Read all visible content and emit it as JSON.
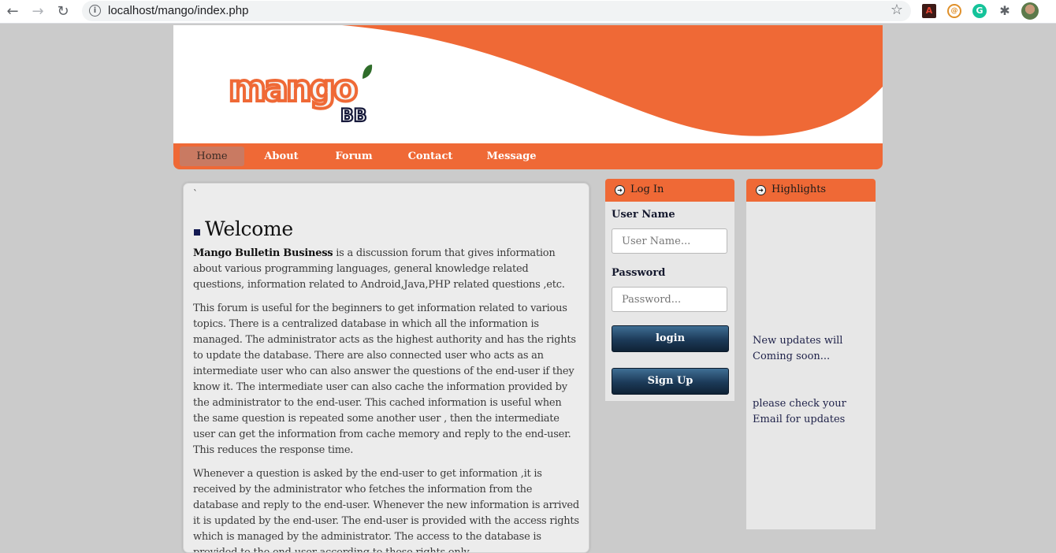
{
  "browser": {
    "url": "localhost/mango/index.php",
    "back_icon": "←",
    "forward_icon": "→",
    "reload_icon": "↻",
    "info_icon": "i",
    "star_icon": "☆",
    "puzzle_icon": "✱"
  },
  "logo": {
    "text": "mango",
    "badge": "BB"
  },
  "nav": {
    "items": [
      {
        "label": "Home",
        "active": true
      },
      {
        "label": "About"
      },
      {
        "label": "Forum"
      },
      {
        "label": "Contact"
      },
      {
        "label": "Message"
      }
    ]
  },
  "main": {
    "tick": "`",
    "heading": "Welcome",
    "intro_bold": "Mango Bulletin Business",
    "intro_rest": " is a discussion forum that gives information about various programming languages, general knowledge related questions, information related to Android,Java,PHP related questions ,etc.",
    "para2": "This forum is useful for the beginners to get information related to various topics. There is a centralized database in which all the information is managed. The administrator acts as the highest authority and has the rights to update the database. There are also connected user who acts as an intermediate user who can also answer the questions of the end-user if they know it. The intermediate user can also cache the information provided by the administrator to the end-user. This cached information is useful when the same question is repeated some another user , then the intermediate user can get the information from cache memory and reply to the end-user. This reduces the response time.",
    "para3": "Whenever a question is asked by the end-user to get information ,it is received by the administrator who fetches the information from the database and reply to the end-user. Whenever the new information is arrived it is updated by the end-user. The end-user is provided with the access rights which is managed by the administrator. The access to the database is provided to the end-user according to these rights only."
  },
  "login": {
    "title": "Log In",
    "username_label": "User Name",
    "username_placeholder": "User Name...",
    "password_label": "Password",
    "password_placeholder": "Password...",
    "login_button": "login",
    "signup_button": "Sign Up"
  },
  "highlights": {
    "title": "Highlights",
    "text1": "New updates will Coming soon...",
    "text2": "please check your Email for updates"
  },
  "colors": {
    "accent": "#ef6936",
    "page_bg": "#cbcbcb",
    "panel_bg": "#e7e7e7",
    "button_dark": "#1c3a58"
  }
}
